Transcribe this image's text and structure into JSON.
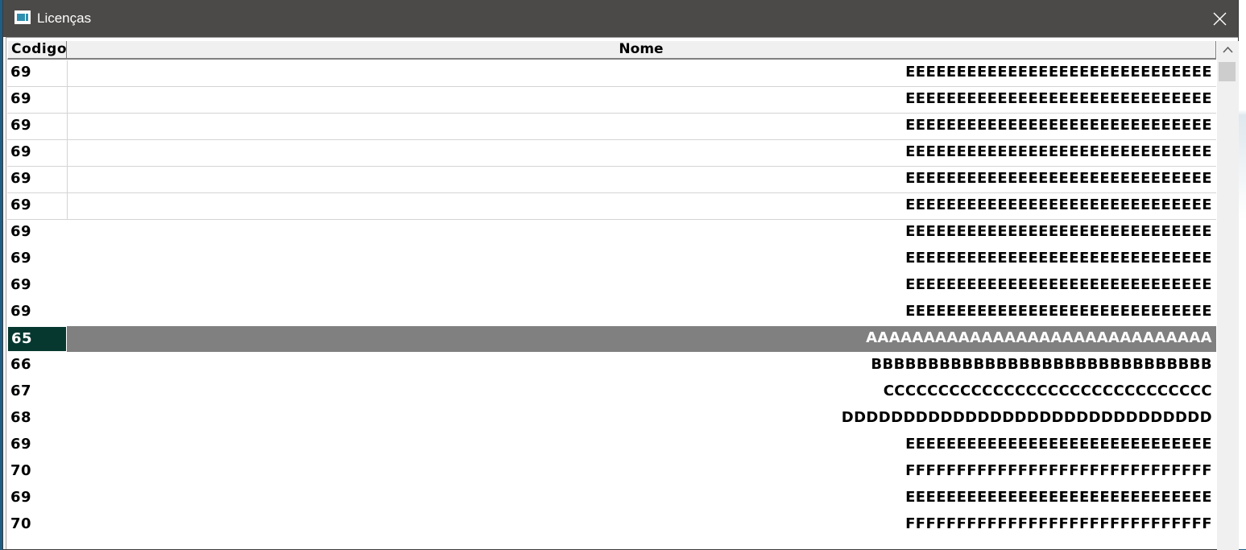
{
  "window": {
    "title": "Licenças",
    "app_icon": "window-app-icon",
    "close_icon": "close-icon"
  },
  "grid": {
    "columns": [
      "Codigo",
      "Nome"
    ],
    "selected_row_index": 10,
    "rows": [
      {
        "codigo": "69",
        "nome": "EEEEEEEEEEEEEEEEEEEEEEEEEEEEEE"
      },
      {
        "codigo": "69",
        "nome": "EEEEEEEEEEEEEEEEEEEEEEEEEEEEEE"
      },
      {
        "codigo": "69",
        "nome": "EEEEEEEEEEEEEEEEEEEEEEEEEEEEEE"
      },
      {
        "codigo": "69",
        "nome": "EEEEEEEEEEEEEEEEEEEEEEEEEEEEEE"
      },
      {
        "codigo": "69",
        "nome": "EEEEEEEEEEEEEEEEEEEEEEEEEEEEEE"
      },
      {
        "codigo": "69",
        "nome": "EEEEEEEEEEEEEEEEEEEEEEEEEEEEEE"
      },
      {
        "codigo": "69",
        "nome": "EEEEEEEEEEEEEEEEEEEEEEEEEEEEEE"
      },
      {
        "codigo": "69",
        "nome": "EEEEEEEEEEEEEEEEEEEEEEEEEEEEEE"
      },
      {
        "codigo": "69",
        "nome": "EEEEEEEEEEEEEEEEEEEEEEEEEEEEEE"
      },
      {
        "codigo": "69",
        "nome": "EEEEEEEEEEEEEEEEEEEEEEEEEEEEEE"
      },
      {
        "codigo": "65",
        "nome": "AAAAAAAAAAAAAAAAAAAAAAAAAAAAAA"
      },
      {
        "codigo": "66",
        "nome": "BBBBBBBBBBBBBBBBBBBBBBBBBBBBBB"
      },
      {
        "codigo": "67",
        "nome": "CCCCCCCCCCCCCCCCCCCCCCCCCCCCCC"
      },
      {
        "codigo": "68",
        "nome": "DDDDDDDDDDDDDDDDDDDDDDDDDDDDDD"
      },
      {
        "codigo": "69",
        "nome": "EEEEEEEEEEEEEEEEEEEEEEEEEEEEEE"
      },
      {
        "codigo": "70",
        "nome": "FFFFFFFFFFFFFFFFFFFFFFFFFFFFFF"
      },
      {
        "codigo": "69",
        "nome": "EEEEEEEEEEEEEEEEEEEEEEEEEEEEEE"
      },
      {
        "codigo": "70",
        "nome": "FFFFFFFFFFFFFFFFFFFFFFFFFFFFFF"
      }
    ]
  },
  "scrollbar": {
    "up_icon": "scroll-up-arrow-icon"
  },
  "colors": {
    "titlebar": "#4c4a48",
    "selection_code_bg": "#063830",
    "selection_name_bg": "#808080",
    "header_bg": "#f0f0f0"
  }
}
